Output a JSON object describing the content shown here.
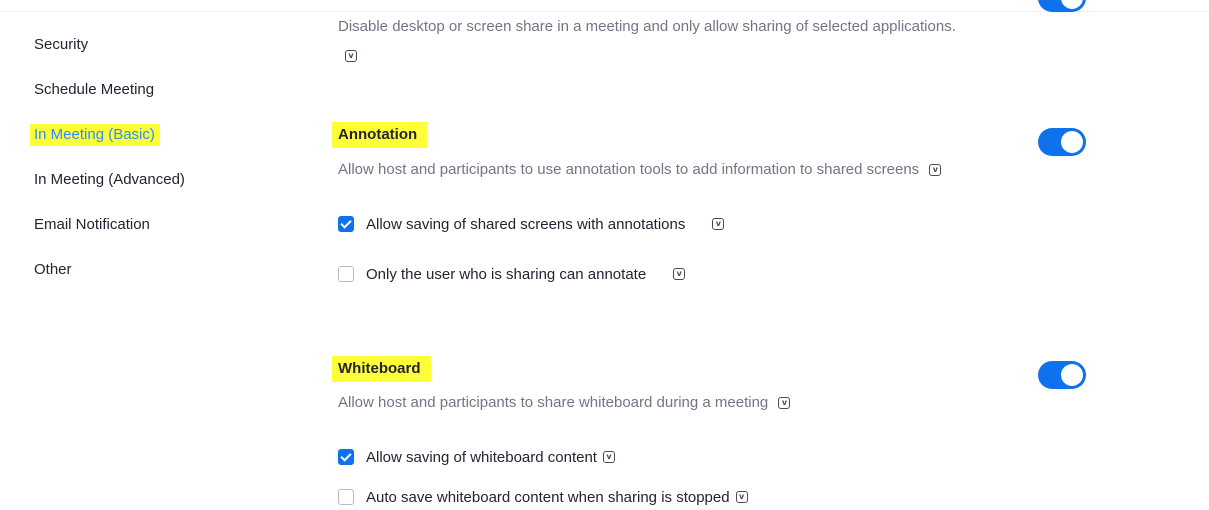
{
  "sidebar": {
    "items": [
      {
        "label": "Security"
      },
      {
        "label": "Schedule Meeting"
      },
      {
        "label": "In Meeting (Basic)",
        "active": true
      },
      {
        "label": "In Meeting (Advanced)"
      },
      {
        "label": "Email Notification"
      },
      {
        "label": "Other"
      }
    ]
  },
  "screen_share": {
    "description": "Disable desktop or screen share in a meeting and only allow sharing of selected applications.",
    "enabled": true
  },
  "annotation": {
    "title": "Annotation",
    "description": "Allow host and participants to use annotation tools to add information to shared screens",
    "enabled": true,
    "options": [
      {
        "label": "Allow saving of shared screens with annotations",
        "checked": true
      },
      {
        "label": "Only the user who is sharing can annotate",
        "checked": false
      }
    ]
  },
  "whiteboard": {
    "title": "Whiteboard",
    "description": "Allow host and participants to share whiteboard during a meeting",
    "enabled": true,
    "options": [
      {
        "label": "Allow saving of whiteboard content",
        "checked": true
      },
      {
        "label": "Auto save whiteboard content when sharing is stopped",
        "checked": false
      }
    ]
  },
  "colors": {
    "accent": "#0e72ed",
    "highlight": "#ffff37",
    "active_link": "#2d8cff"
  },
  "icons": {
    "info": "info-icon"
  }
}
